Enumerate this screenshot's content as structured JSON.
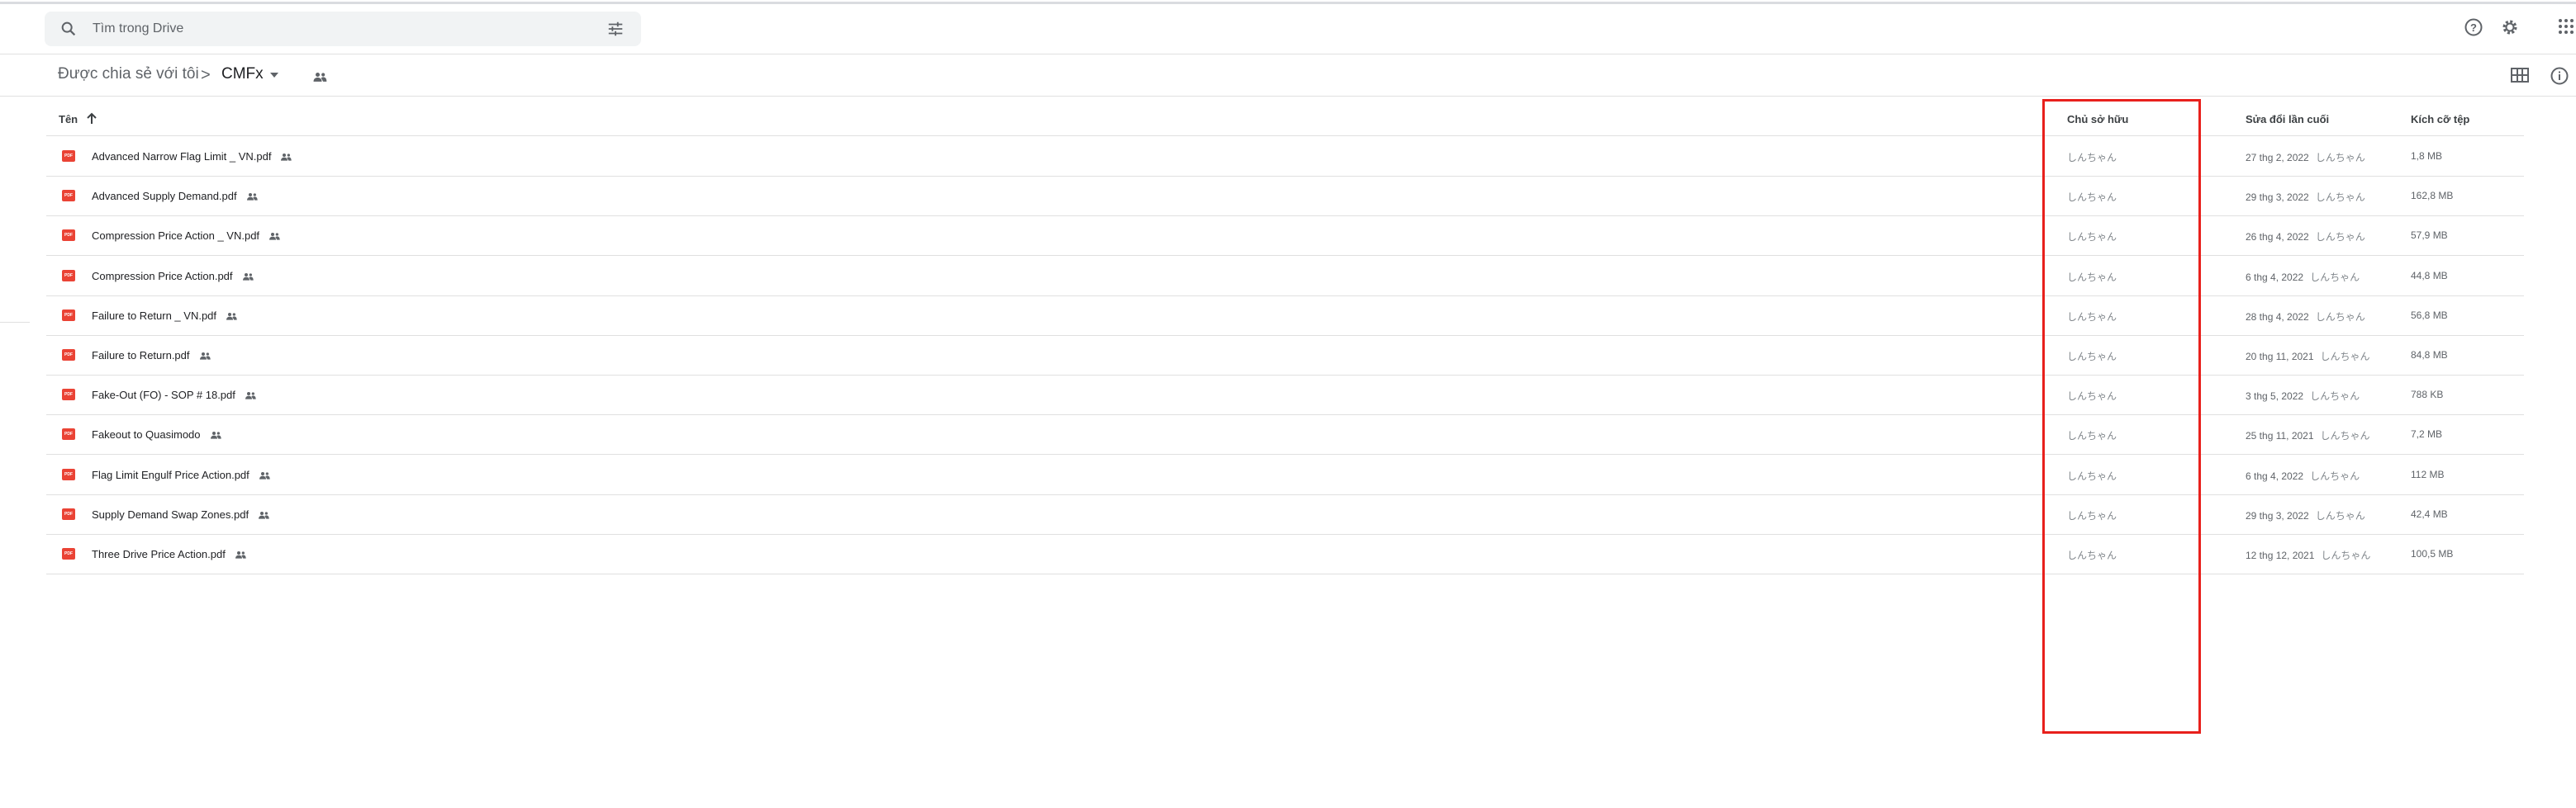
{
  "search": {
    "placeholder": "Tìm trong Drive",
    "icon": "search-icon",
    "options_icon": "tune-icon"
  },
  "header": {
    "help_icon": "help-icon",
    "settings_icon": "gear-icon",
    "apps_icon": "apps-grid-icon"
  },
  "breadcrumb": {
    "root": "Được chia sẻ với tôi",
    "separator": ">",
    "current": "CMFx"
  },
  "view": {
    "grid_icon": "grid-view-icon",
    "info_icon": "info-icon"
  },
  "columns": {
    "name": "Tên",
    "owner": "Chủ sở hữu",
    "modified": "Sửa đổi lần cuối",
    "size": "Kích cỡ tệp"
  },
  "file_badge": "PDF",
  "files": [
    {
      "name": "Advanced Narrow Flag Limit _ VN.pdf",
      "owner": "しんちゃん",
      "modified": "27 thg 2, 2022",
      "modified_by": "しんちゃん",
      "size": "1,8 MB"
    },
    {
      "name": "Advanced Supply Demand.pdf",
      "owner": "しんちゃん",
      "modified": "29 thg 3, 2022",
      "modified_by": "しんちゃん",
      "size": "162,8 MB"
    },
    {
      "name": "Compression Price Action _ VN.pdf",
      "owner": "しんちゃん",
      "modified": "26 thg 4, 2022",
      "modified_by": "しんちゃん",
      "size": "57,9 MB"
    },
    {
      "name": "Compression Price Action.pdf",
      "owner": "しんちゃん",
      "modified": "6 thg 4, 2022",
      "modified_by": "しんちゃん",
      "size": "44,8 MB"
    },
    {
      "name": "Failure to Return _ VN.pdf",
      "owner": "しんちゃん",
      "modified": "28 thg 4, 2022",
      "modified_by": "しんちゃん",
      "size": "56,8 MB"
    },
    {
      "name": "Failure to Return.pdf",
      "owner": "しんちゃん",
      "modified": "20 thg 11, 2021",
      "modified_by": "しんちゃん",
      "size": "84,8 MB"
    },
    {
      "name": "Fake-Out (FO) - SOP # 18.pdf",
      "owner": "しんちゃん",
      "modified": "3 thg 5, 2022",
      "modified_by": "しんちゃん",
      "size": "788 KB"
    },
    {
      "name": "Fakeout to Quasimodo",
      "owner": "しんちゃん",
      "modified": "25 thg 11, 2021",
      "modified_by": "しんちゃん",
      "size": "7,2 MB"
    },
    {
      "name": "Flag Limit Engulf Price Action.pdf",
      "owner": "しんちゃん",
      "modified": "6 thg 4, 2022",
      "modified_by": "しんちゃん",
      "size": "112 MB"
    },
    {
      "name": "Supply Demand Swap Zones.pdf",
      "owner": "しんちゃん",
      "modified": "29 thg 3, 2022",
      "modified_by": "しんちゃん",
      "size": "42,4 MB"
    },
    {
      "name": "Three Drive Price Action.pdf",
      "owner": "しんちゃん",
      "modified": "12 thg 12, 2021",
      "modified_by": "しんちゃん",
      "size": "100,5 MB"
    }
  ],
  "colors": {
    "pdf_icon": "#ea4335",
    "highlight_box": "#e8201c"
  }
}
